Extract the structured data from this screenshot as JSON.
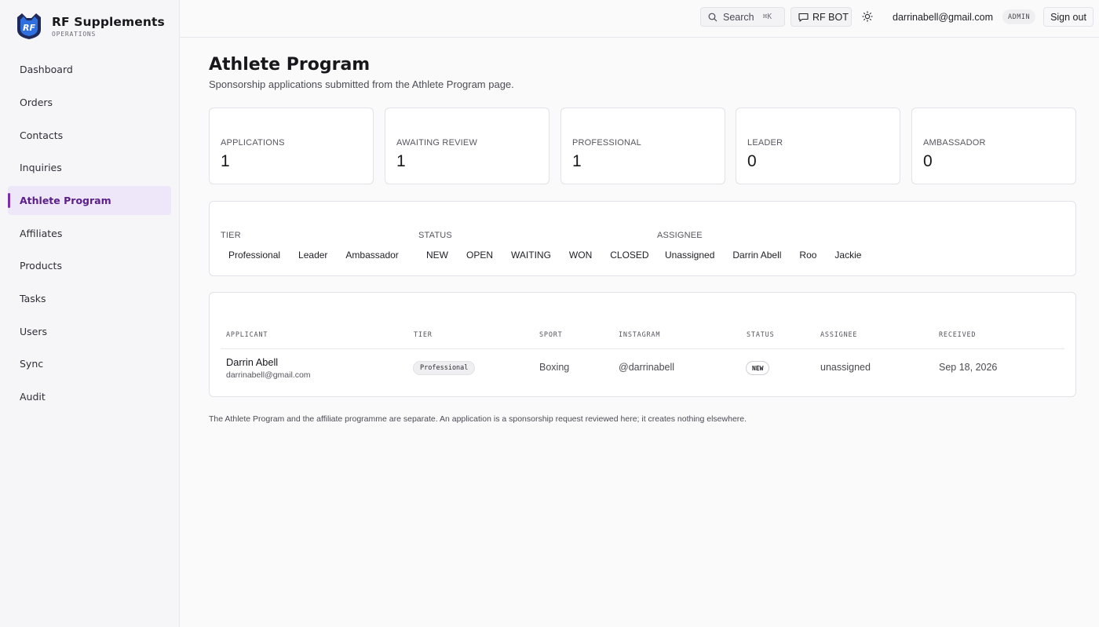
{
  "brand": {
    "name": "RF Supplements",
    "subtitle": "OPERATIONS",
    "logo_text": "RF"
  },
  "sidebar": {
    "items": [
      {
        "label": "Dashboard"
      },
      {
        "label": "Orders"
      },
      {
        "label": "Contacts"
      },
      {
        "label": "Inquiries"
      },
      {
        "label": "Athlete Program",
        "active": true
      },
      {
        "label": "Affiliates"
      },
      {
        "label": "Products"
      },
      {
        "label": "Tasks"
      },
      {
        "label": "Users"
      },
      {
        "label": "Sync"
      },
      {
        "label": "Audit"
      }
    ]
  },
  "topbar": {
    "search_label": "Search",
    "search_shortcut": "⌘K",
    "bot_label": "RF BOT",
    "user_email": "darrinabell@gmail.com",
    "role": "ADMIN",
    "signout_label": "Sign out"
  },
  "page": {
    "title": "Athlete Program",
    "subtitle": "Sponsorship applications submitted from the Athlete Program page."
  },
  "stats": [
    {
      "label": "APPLICATIONS",
      "value": "1"
    },
    {
      "label": "AWAITING REVIEW",
      "value": "1"
    },
    {
      "label": "PROFESSIONAL",
      "value": "1"
    },
    {
      "label": "LEADER",
      "value": "0"
    },
    {
      "label": "AMBASSADOR",
      "value": "0"
    }
  ],
  "filters": {
    "tier": {
      "label": "TIER",
      "options": [
        "Professional",
        "Leader",
        "Ambassador"
      ]
    },
    "status": {
      "label": "STATUS",
      "options": [
        "NEW",
        "OPEN",
        "WAITING",
        "WON",
        "CLOSED"
      ]
    },
    "assignee": {
      "label": "ASSIGNEE",
      "options": [
        "Unassigned",
        "Darrin Abell",
        "Roo",
        "Jackie"
      ]
    }
  },
  "table": {
    "columns": [
      "APPLICANT",
      "TIER",
      "SPORT",
      "INSTAGRAM",
      "STATUS",
      "ASSIGNEE",
      "RECEIVED"
    ],
    "rows": [
      {
        "name": "Darrin Abell",
        "email": "darrinabell@gmail.com",
        "tier": "Professional",
        "sport": "Boxing",
        "instagram": "@darrinabell",
        "status": "NEW",
        "assignee": "unassigned",
        "received": "Sep 18, 2026"
      }
    ]
  },
  "footnote": "The Athlete Program and the affiliate programme are separate. An application is a sponsorship request reviewed here; it creates nothing elsewhere.",
  "colors": {
    "accent": "#7a2fb0",
    "active_bg": "#ede7f9",
    "logo_blue": "#2f6fe0",
    "logo_dark": "#1f2a5a"
  },
  "icons": {
    "search": "search-icon",
    "bot": "chat-icon",
    "theme": "sun-icon"
  }
}
